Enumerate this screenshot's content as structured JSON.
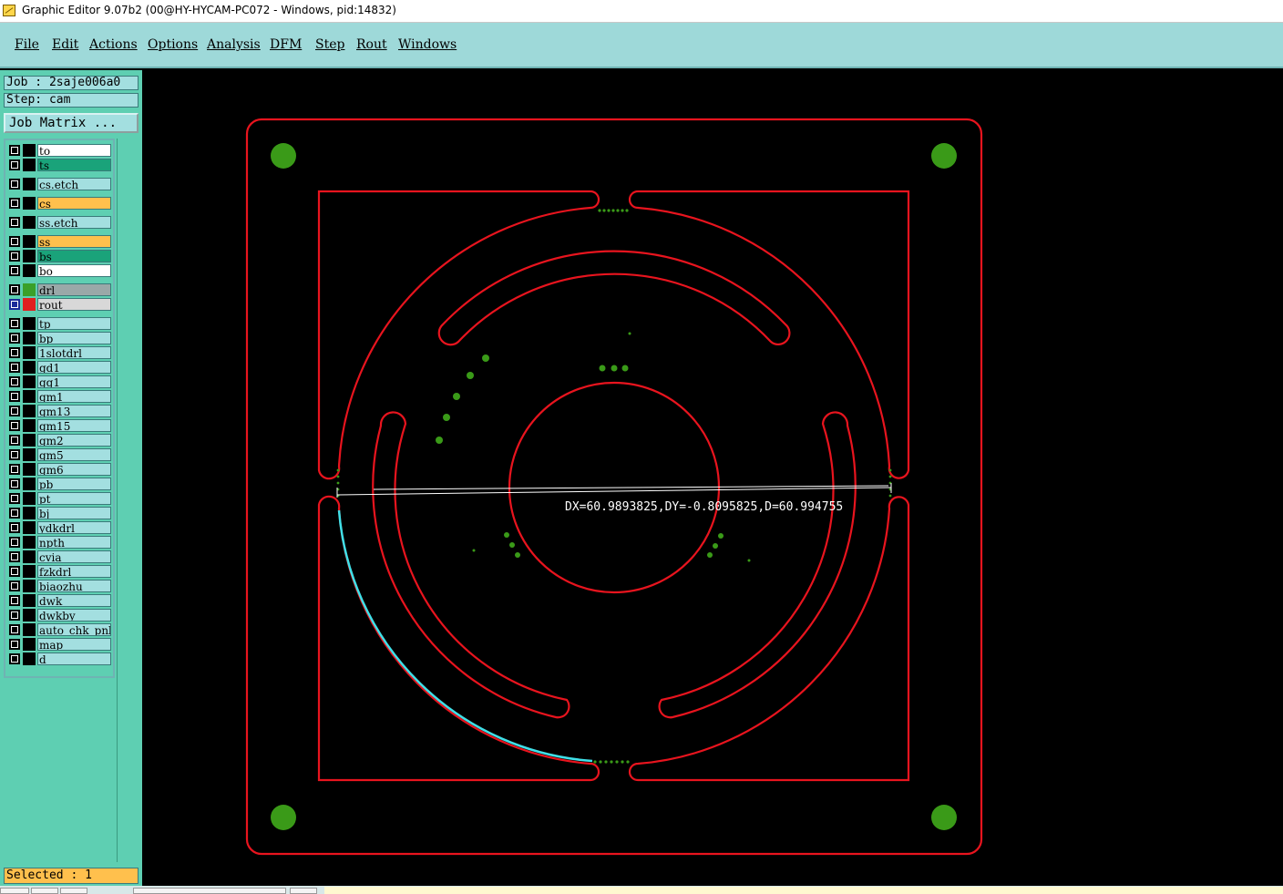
{
  "window": {
    "title": "Graphic Editor 9.07b2 (00@HY-HYCAM-PC072 - Windows, pid:14832)"
  },
  "menu": [
    "File",
    "Edit",
    "Actions",
    "Options",
    "Analysis",
    "DFM",
    "Step",
    "Rout",
    "Windows"
  ],
  "job": {
    "label": "Job : 2saje006a0",
    "step": "Step: cam",
    "matrix_button": "Job Matrix ..."
  },
  "layers": [
    {
      "name": "to",
      "bg": "#ffffff",
      "swatch": "#000000"
    },
    {
      "name": "ts",
      "bg": "#1aa37a",
      "swatch": "#000000"
    },
    {
      "name": "cs.etch",
      "bg": "#a3dfe0",
      "swatch": "#000000"
    },
    {
      "name": "cs",
      "bg": "#ffc04d",
      "swatch": "#000000"
    },
    {
      "name": "ss.etch",
      "bg": "#a3dfe0",
      "swatch": "#000000"
    },
    {
      "name": "ss",
      "bg": "#ffc04d",
      "swatch": "#000000"
    },
    {
      "name": "bs",
      "bg": "#1aa37a",
      "swatch": "#000000"
    },
    {
      "name": "bo",
      "bg": "#ffffff",
      "swatch": "#000000"
    },
    {
      "name": "drl",
      "bg": "#9aa8a8",
      "swatch": "#3aa02a"
    },
    {
      "name": "rout",
      "bg": "#d8d8d8",
      "swatch": "#e02020",
      "active": true
    },
    {
      "name": "tp",
      "bg": "#a3dfe0",
      "swatch": "#000000"
    },
    {
      "name": "bp",
      "bg": "#a3dfe0",
      "swatch": "#000000"
    },
    {
      "name": "1slotdrl",
      "bg": "#a3dfe0",
      "swatch": "#000000"
    },
    {
      "name": "gd1",
      "bg": "#a3dfe0",
      "swatch": "#000000"
    },
    {
      "name": "gg1",
      "bg": "#a3dfe0",
      "swatch": "#000000"
    },
    {
      "name": "gm1",
      "bg": "#a3dfe0",
      "swatch": "#000000"
    },
    {
      "name": "gm13",
      "bg": "#a3dfe0",
      "swatch": "#000000"
    },
    {
      "name": "gm15",
      "bg": "#a3dfe0",
      "swatch": "#000000"
    },
    {
      "name": "gm2",
      "bg": "#a3dfe0",
      "swatch": "#000000"
    },
    {
      "name": "gm5",
      "bg": "#a3dfe0",
      "swatch": "#000000"
    },
    {
      "name": "gm6",
      "bg": "#a3dfe0",
      "swatch": "#000000"
    },
    {
      "name": "pb",
      "bg": "#a3dfe0",
      "swatch": "#000000"
    },
    {
      "name": "pt",
      "bg": "#a3dfe0",
      "swatch": "#000000"
    },
    {
      "name": "bj",
      "bg": "#a3dfe0",
      "swatch": "#000000"
    },
    {
      "name": "ydkdrl",
      "bg": "#a3dfe0",
      "swatch": "#000000"
    },
    {
      "name": "npth",
      "bg": "#a3dfe0",
      "swatch": "#000000"
    },
    {
      "name": "cvia",
      "bg": "#a3dfe0",
      "swatch": "#000000"
    },
    {
      "name": "fzkdrl",
      "bg": "#a3dfe0",
      "swatch": "#000000"
    },
    {
      "name": "biaozhu",
      "bg": "#a3dfe0",
      "swatch": "#000000"
    },
    {
      "name": "dwk",
      "bg": "#a3dfe0",
      "swatch": "#000000"
    },
    {
      "name": "dwkby",
      "bg": "#a3dfe0",
      "swatch": "#000000"
    },
    {
      "name": "auto_chk_pnl",
      "bg": "#a3dfe0",
      "swatch": "#000000"
    },
    {
      "name": "map",
      "bg": "#a3dfe0",
      "swatch": "#000000"
    },
    {
      "name": "d",
      "bg": "#a3dfe0",
      "swatch": "#000000"
    }
  ],
  "status": {
    "selected": "Selected : 1"
  },
  "canvas": {
    "measure": "DX=60.9893825,DY=-0.8095825,D=60.994755"
  },
  "colors": {
    "rout": "#e8141e",
    "drill": "#3a9a18",
    "selected": "#40e0e8",
    "measure": "#ffffff"
  }
}
